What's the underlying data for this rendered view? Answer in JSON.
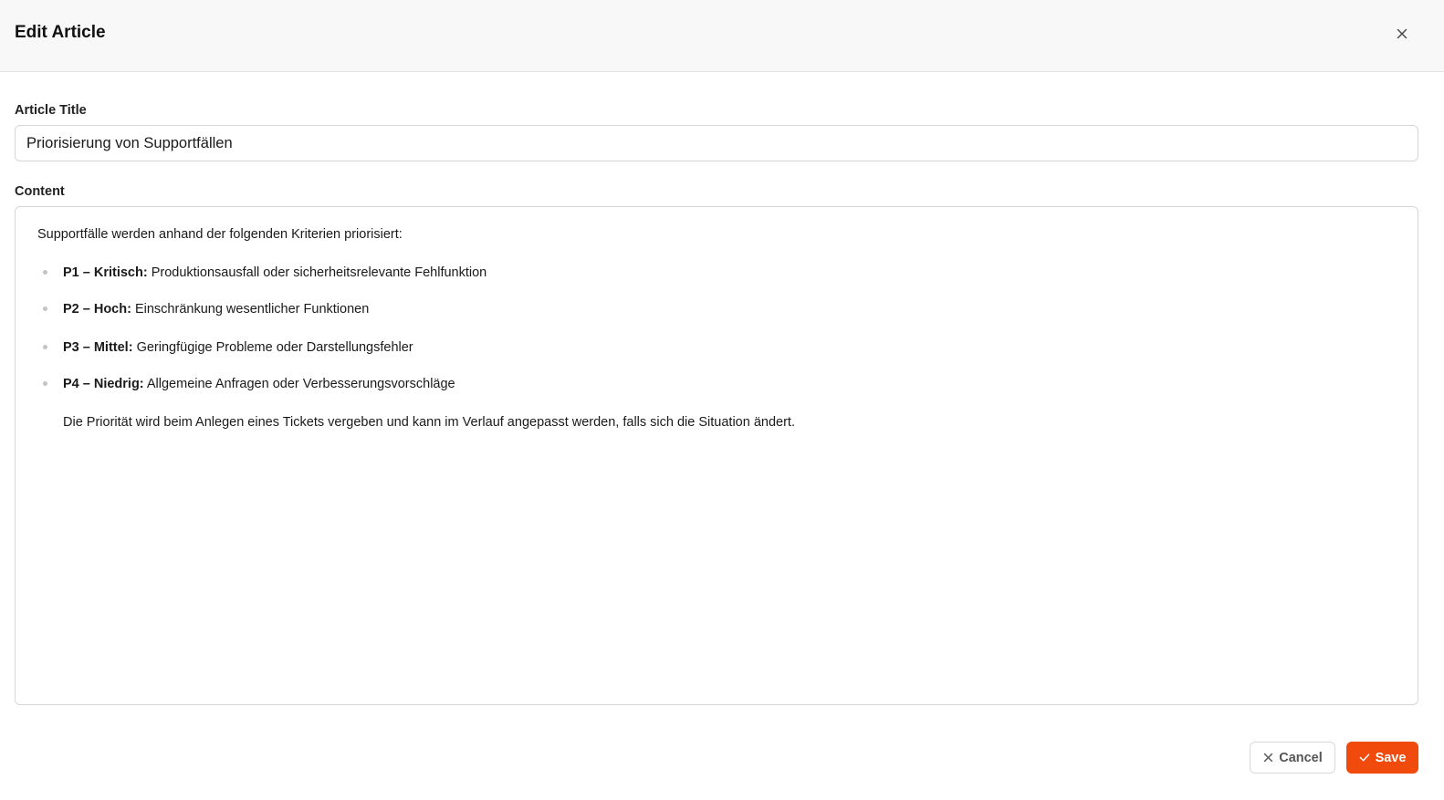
{
  "header": {
    "title": "Edit Article",
    "close_icon": "close-icon"
  },
  "form": {
    "title_label": "Article Title",
    "title_value": "Priorisierung von Supportfällen",
    "content_label": "Content"
  },
  "content": {
    "intro": "Supportfälle werden anhand der folgenden Kriterien priorisiert:",
    "items": [
      {
        "label": "P1 – Kritisch:",
        "text": " Produktionsausfall oder sicherheitsrelevante Fehlfunktion"
      },
      {
        "label": "P2 – Hoch:",
        "text": " Einschränkung wesentlicher Funktionen"
      },
      {
        "label": "P3 – Mittel:",
        "text": " Geringfügige Probleme oder Darstellungsfehler"
      },
      {
        "label": "P4 – Niedrig:",
        "text": " Allgemeine Anfragen oder Verbesserungsvorschläge"
      }
    ],
    "outro": "Die Priorität wird beim Anlegen eines Tickets vergeben und kann im Verlauf angepasst werden, falls sich die Situation ändert."
  },
  "footer": {
    "cancel_label": "Cancel",
    "save_label": "Save",
    "cancel_icon": "x-icon",
    "save_icon": "check-icon"
  },
  "colors": {
    "accent": "#f04a0c",
    "header_bg": "#f8f8f8",
    "border": "#d6d6d6"
  }
}
